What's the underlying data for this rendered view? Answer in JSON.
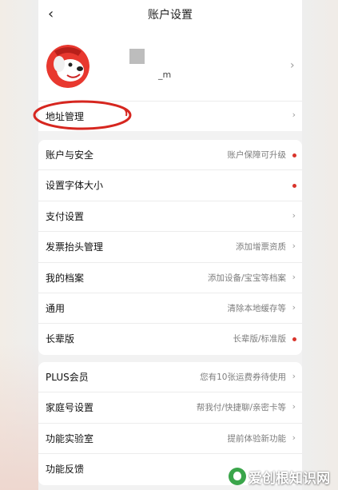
{
  "header": {
    "back_icon": "chevron-left-icon",
    "back_glyph": "‹",
    "title": "账户设置"
  },
  "profile": {
    "avatar_icon": "avatar-joy-dog-icon",
    "username_suffix": "_m",
    "chevron": "›"
  },
  "address": {
    "label": "地址管理",
    "chevron": "›"
  },
  "settings": [
    {
      "label": "账户与安全",
      "value": "账户保障可升级",
      "marker": "dot"
    },
    {
      "label": "设置字体大小",
      "value": "",
      "marker": "dot"
    },
    {
      "label": "支付设置",
      "value": "",
      "marker": "chevron"
    },
    {
      "label": "发票抬头管理",
      "value": "添加增票资质",
      "marker": "chevron"
    },
    {
      "label": "我的档案",
      "value": "添加设备/宝宝等档案",
      "marker": "chevron"
    },
    {
      "label": "通用",
      "value": "清除本地缓存等",
      "marker": "chevron"
    },
    {
      "label": "长辈版",
      "value": "长辈版/标准版",
      "marker": "dot"
    }
  ],
  "more": [
    {
      "label": "PLUS会员",
      "value": "您有10张运费券待使用",
      "marker": "chevron"
    },
    {
      "label": "家庭号设置",
      "value": "帮我付/快捷聊/亲密卡等",
      "marker": "chevron"
    },
    {
      "label": "功能实验室",
      "value": "提前体验新功能",
      "marker": "chevron"
    },
    {
      "label": "功能反馈",
      "value": "",
      "marker": "none"
    }
  ],
  "chevron_glyph": "›",
  "accent_red": "#d9342b",
  "annotation_color": "#d6261f",
  "watermark": {
    "text": "爱创根知识网",
    "logo_icon": "watermark-logo-icon"
  }
}
